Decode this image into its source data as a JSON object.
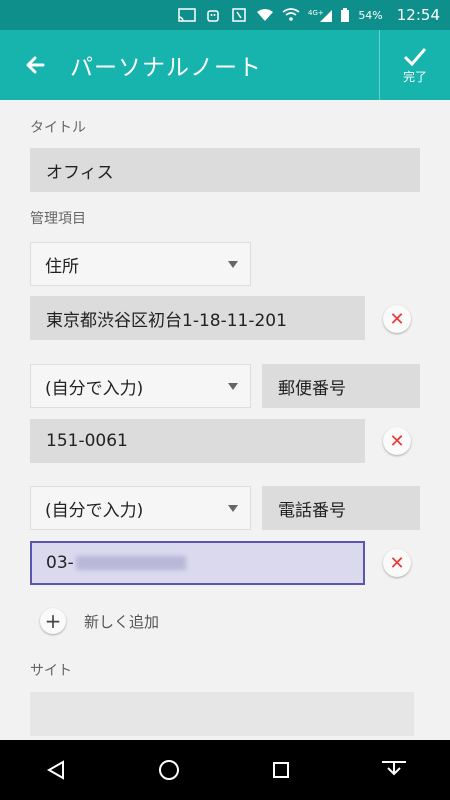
{
  "status": {
    "battery": "54%",
    "time": "12:54"
  },
  "toolbar": {
    "title": "パーソナルノート",
    "done_label": "完了"
  },
  "form": {
    "title_label": "タイトル",
    "title_value": "オフィス",
    "items_label": "管理項目",
    "address_type": "住所",
    "address_value": "東京都渋谷区初台1-18-11-201",
    "custom1_select": "(自分で入力)",
    "custom1_name": "郵便番号",
    "custom1_value": "151-0061",
    "custom2_select": "(自分で入力)",
    "custom2_name": "電話番号",
    "custom2_value_prefix": "03-",
    "add_label": "新しく追加",
    "site_label": "サイト"
  },
  "colors": {
    "statusbar": "#0f8f8b",
    "toolbar": "#17b3ad",
    "remove": "#e53935",
    "active_border": "#5a55b0"
  }
}
